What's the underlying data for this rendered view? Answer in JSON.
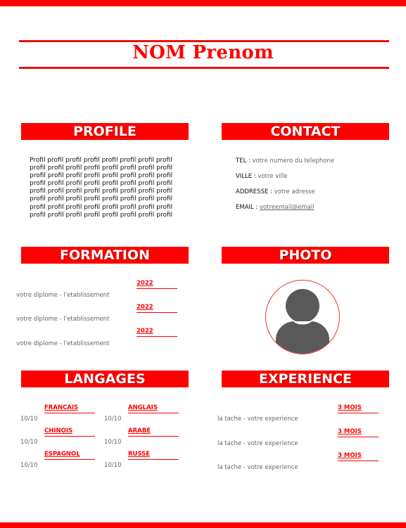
{
  "header": {
    "name": "NOM Prenom"
  },
  "sections": {
    "profile": "PROFILE",
    "contact": "CONTACT",
    "formation": "FORMATION",
    "photo": "PHOTO",
    "langages": "LANGAGES",
    "experience": "EXPERIENCE"
  },
  "profile": {
    "lines": [
      "Profil profil profil profil profil profil profil profil",
      "profil profil profil profil profil profil profil profil",
      "profil profil profil profil profil profil profil profil",
      "profil profil profil profil profil profil profil profil",
      "profil profil profil profil profil profil profil profil",
      "profil profil profil profil profil profil profil profil",
      "profil profil profil profil profil profil profil profil",
      "profil profil profil profil profil profil profil profil"
    ]
  },
  "contact": {
    "tel_label": "TEL : ",
    "tel_value": "votre numero du telephone",
    "ville_label": "VILLE : ",
    "ville_value": "votre ville",
    "adresse_label": "ADDRESSE : ",
    "adresse_value": "votre adresse",
    "email_label": "EMAIL : ",
    "email_value": "votreemail@email"
  },
  "formation": [
    {
      "year": "2022",
      "text": "votre diplome - l'etablissement"
    },
    {
      "year": "2022",
      "text": "votre diplome - l'etablissement"
    },
    {
      "year": "2022",
      "text": "votre diplome - l'etablissement"
    }
  ],
  "langages": [
    {
      "name": "FRANCAIS",
      "score": "10/10"
    },
    {
      "name": "ANGLAIS",
      "score": "10/10"
    },
    {
      "name": "CHINOIS",
      "score": "10/10"
    },
    {
      "name": "ARABE",
      "score": "10/10"
    },
    {
      "name": "ESPAGNOL",
      "score": "10/10"
    },
    {
      "name": "RUSSE",
      "score": "10/10"
    }
  ],
  "experience": [
    {
      "duration": "3 MOIS",
      "text": "la tache - votre experience"
    },
    {
      "duration": "3 MOIS",
      "text": "la tache - votre experience"
    },
    {
      "duration": "3 MOIS",
      "text": "la tache - votre experience"
    }
  ],
  "colors": {
    "accent": "#ff0000",
    "text": "#111111",
    "muted": "#666666",
    "avatar": "#595959"
  }
}
